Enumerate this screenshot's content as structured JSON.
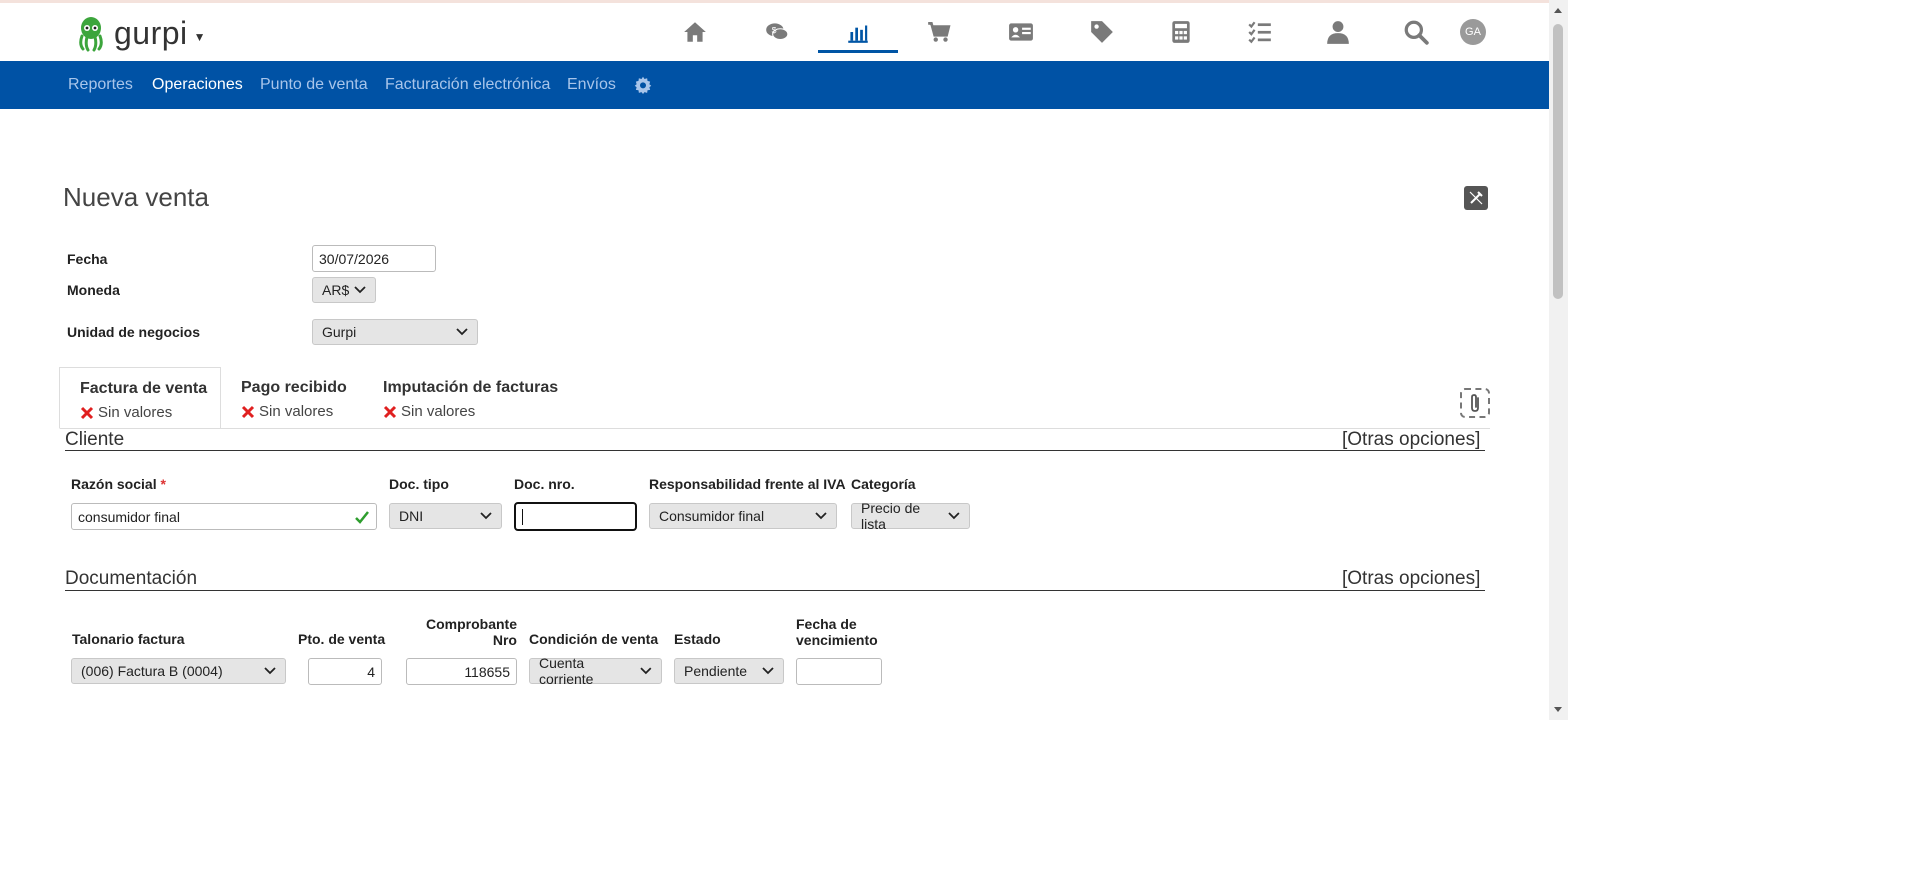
{
  "app": {
    "logo_text": "gurpi",
    "avatar_initials": "GA",
    "accent_color": "#0052a5"
  },
  "top_icons": [
    "home-icon",
    "chat-money-icon",
    "chart-icon",
    "cart-icon",
    "contact-card-icon",
    "tag-icon",
    "calculator-icon",
    "checklist-icon",
    "user-icon",
    "search-icon"
  ],
  "nav": {
    "items": [
      "Reportes",
      "Operaciones",
      "Punto de venta",
      "Facturación electrónica",
      "Envíos"
    ],
    "active": "Operaciones"
  },
  "page": {
    "title": "Nueva venta"
  },
  "form": {
    "fecha_label": "Fecha",
    "fecha_value": "30/07/2026",
    "moneda_label": "Moneda",
    "moneda_value": "AR$",
    "unidad_label": "Unidad de negocios",
    "unidad_value": "Gurpi"
  },
  "tabs": [
    {
      "title": "Factura de venta",
      "status": "Sin valores",
      "active": true
    },
    {
      "title": "Pago recibido",
      "status": "Sin valores",
      "active": false
    },
    {
      "title": "Imputación de facturas",
      "status": "Sin valores",
      "active": false
    }
  ],
  "cliente": {
    "section_title": "Cliente",
    "other_options": "[Otras opciones]",
    "razon_label": "Razón social",
    "required_mark": "*",
    "razon_value": "consumidor final",
    "doc_tipo_label": "Doc. tipo",
    "doc_tipo_value": "DNI",
    "doc_nro_label": "Doc. nro.",
    "doc_nro_value": "",
    "iva_label": "Responsabilidad frente al IVA",
    "iva_value": "Consumidor final",
    "categoria_label": "Categoría",
    "categoria_value": "Precio de lista"
  },
  "documentacion": {
    "section_title": "Documentación",
    "other_options": "[Otras opciones]",
    "talonario_label": "Talonario factura",
    "talonario_value": "(006) Factura B (0004)",
    "pto_label": "Pto. de venta",
    "pto_value": "4",
    "comprobante_label_1": "Comprobante",
    "comprobante_label_2": "Nro",
    "comprobante_value": "118655",
    "condicion_label": "Condición de venta",
    "condicion_value": "Cuenta corriente",
    "estado_label": "Estado",
    "estado_value": "Pendiente",
    "vencimiento_label_1": "Fecha de",
    "vencimiento_label_2": "vencimiento",
    "vencimiento_value": ""
  }
}
